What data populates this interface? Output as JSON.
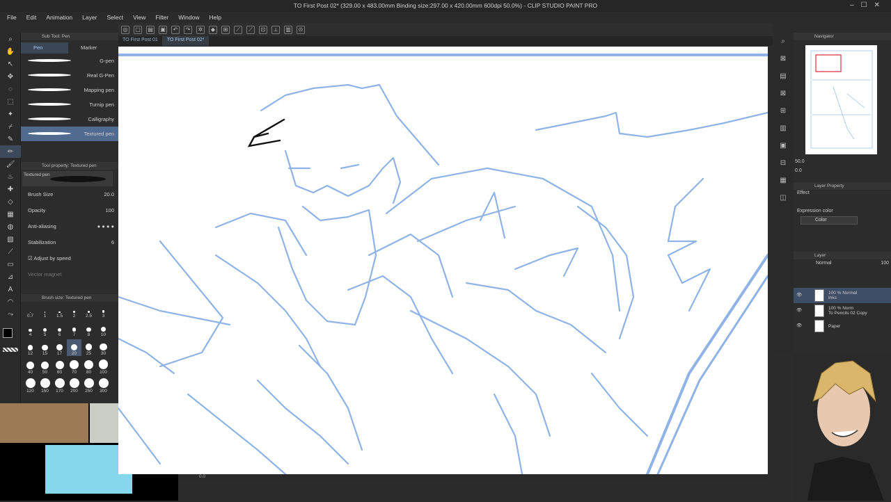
{
  "window": {
    "title": "TO First Post 02* (329.00 x 483.00mm Binding size:297.00 x 420.00mm 600dpi 50.0%) - CLIP STUDIO PAINT PRO"
  },
  "menu": [
    "File",
    "Edit",
    "Animation",
    "Layer",
    "Select",
    "View",
    "Filter",
    "Window",
    "Help"
  ],
  "tabs": [
    "TO First Post 01",
    "TO First Post 02*"
  ],
  "sub_tool": {
    "panel_title": "Sub Tool: Pen",
    "tab_pen": "Pen",
    "tab_marker": "Marker",
    "brushes": [
      "G-pen",
      "Real G-Pen",
      "Mapping pen",
      "Turnip pen",
      "Calligraphy",
      "Textured pen"
    ]
  },
  "tool_property": {
    "panel_title": "Tool property: Textured pen",
    "preset": "Textured pen",
    "brush_size_label": "Brush Size",
    "brush_size_value": "20.0",
    "opacity_label": "Opacity",
    "opacity_value": "100",
    "antialias_label": "Anti-aliasing",
    "stabilization_label": "Stabilization",
    "stabilization_value": "6",
    "adjust_speed_label": "Adjust by speed",
    "vector_magnet_label": "Vector magnet"
  },
  "brush_size_panel": {
    "title": "Brush size: Textured pen",
    "sizes": [
      "0.7",
      "1",
      "1.5",
      "2",
      "2.5",
      "3",
      "4",
      "5",
      "6",
      "7",
      "8",
      "10",
      "12",
      "15",
      "17",
      "20",
      "25",
      "30",
      "40",
      "50",
      "60",
      "70",
      "80",
      "100",
      "120",
      "150",
      "170",
      "200",
      "250",
      "300"
    ]
  },
  "navigator": {
    "title": "Navigator",
    "zoom": "50.0",
    "rotation": "0.0"
  },
  "layer_property": {
    "title": "Layer Property",
    "effect_label": "Effect",
    "expression_label": "Expression color",
    "expression_value": "Color"
  },
  "layer_panel": {
    "title": "Layer",
    "blend_mode": "Normal",
    "opacity": "100",
    "layers": [
      {
        "mode": "100 % Normal",
        "name": "Inks"
      },
      {
        "mode": "100 % Norm",
        "name": "To Pencils 02 Copy"
      },
      {
        "mode": "",
        "name": "Paper"
      }
    ]
  },
  "status": {
    "zoom": "0.0"
  },
  "colors": {
    "accent": "#506a90",
    "sketch": "#8fb3e6",
    "ink": "#111111",
    "webcam_tan": "#9b7a55",
    "webcam_cyan": "#86d6ec"
  }
}
